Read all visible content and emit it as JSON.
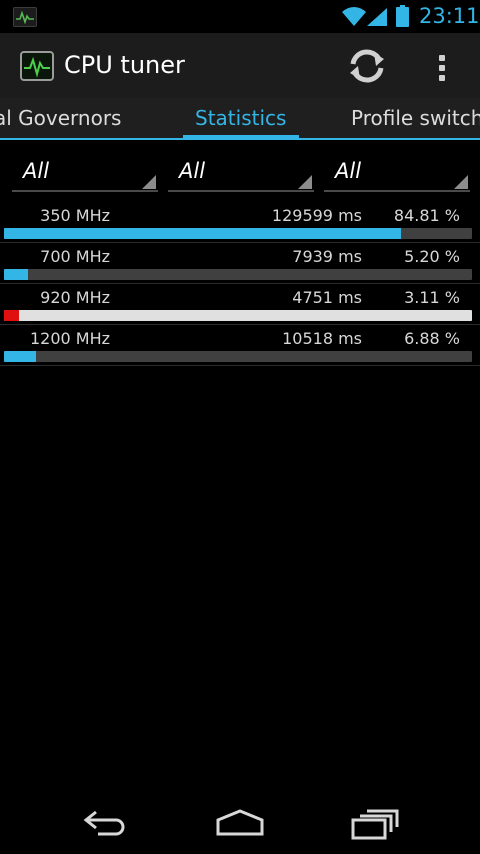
{
  "status_bar": {
    "time": "23:11",
    "icons": [
      "cpu-monitor-notification-icon",
      "wifi-icon",
      "signal-icon",
      "battery-icon"
    ],
    "accent_color": "#33b5e5"
  },
  "action_bar": {
    "title": "CPU tuner",
    "actions": [
      "refresh-icon",
      "overflow-menu-icon"
    ]
  },
  "tabs": [
    {
      "label": "al Governors",
      "selected": false
    },
    {
      "label": "Statistics",
      "selected": true
    },
    {
      "label": "Profile switch",
      "selected": false
    }
  ],
  "filters": [
    {
      "value": "All"
    },
    {
      "value": "All"
    },
    {
      "value": "All"
    }
  ],
  "stats": [
    {
      "freq": "350 MHz",
      "time": "129599 ms",
      "pct": "84.81 %",
      "fraction": 0.8481,
      "active": false
    },
    {
      "freq": "700 MHz",
      "time": "7939 ms",
      "pct": "5.20 %",
      "fraction": 0.052,
      "active": false
    },
    {
      "freq": "920 MHz",
      "time": "4751 ms",
      "pct": "3.11 %",
      "fraction": 0.0311,
      "active": true
    },
    {
      "freq": "1200 MHz",
      "time": "10518 ms",
      "pct": "6.88 %",
      "fraction": 0.0688,
      "active": false
    }
  ],
  "colors": {
    "bar": "#33b5e5",
    "active_bar": "#e01010",
    "track": "#404040",
    "active_track": "#e0e0e0"
  },
  "nav": [
    "back-icon",
    "home-icon",
    "recent-apps-icon"
  ]
}
